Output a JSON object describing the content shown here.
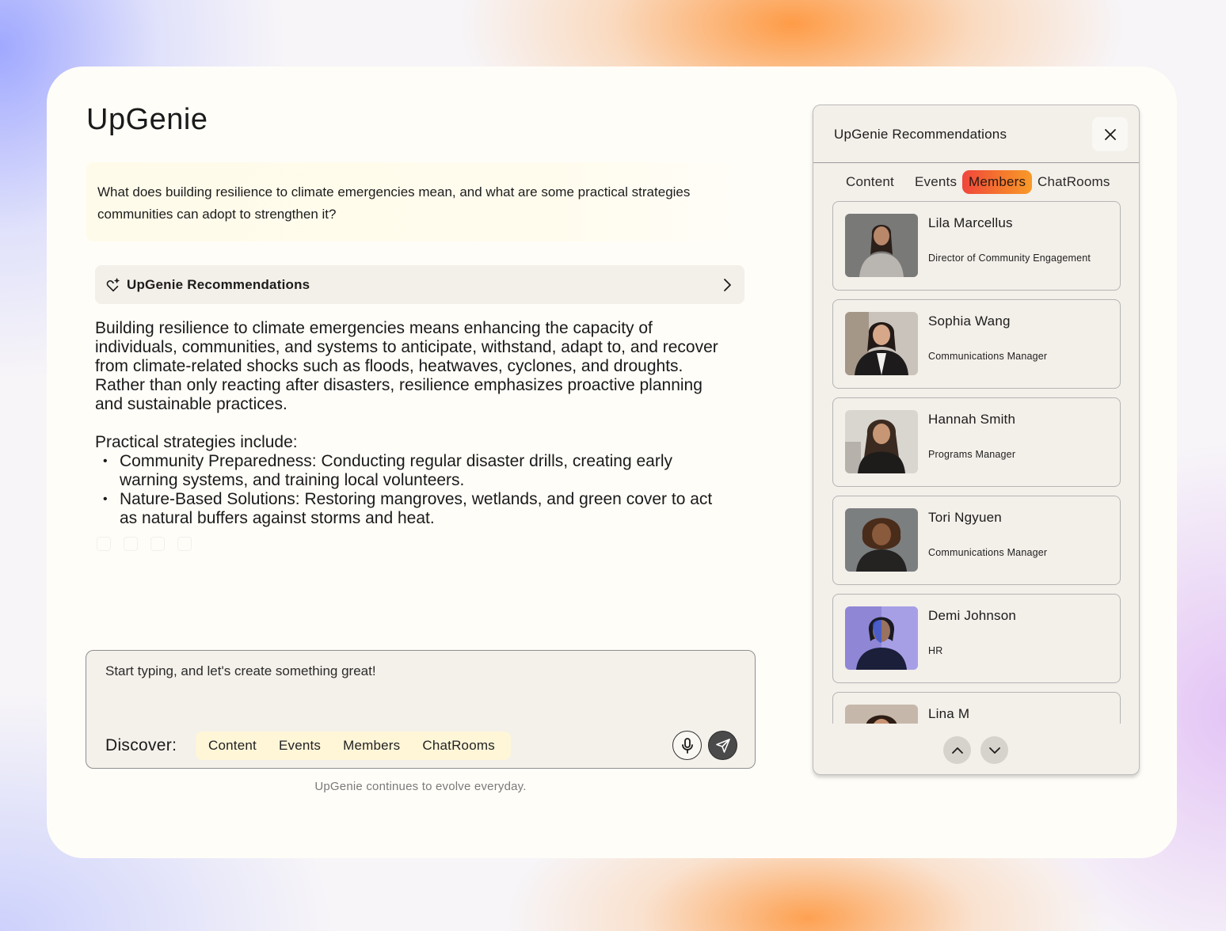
{
  "app": {
    "title": "UpGenie"
  },
  "question": "What does building resilience to climate emergencies mean, and what are some practical strategies communities can adopt to strengthen it?",
  "recommendations_bar": {
    "label": "UpGenie Recommendations",
    "icon": "sparkle-heart-icon"
  },
  "answer": {
    "paragraph": "Building resilience to climate emergencies means enhancing the capacity of individuals, communities, and systems to anticipate, withstand, adapt to, and recover from climate-related shocks such as floods, heatwaves, cyclones, and droughts. Rather than only reacting after disasters, resilience emphasizes proactive planning and sustainable practices.",
    "strategies_heading": "Practical strategies include:",
    "strategies": [
      "Community Preparedness: Conducting regular disaster drills, creating early warning systems, and training local volunteers.",
      "Nature-Based Solutions: Restoring mangroves, wetlands, and green cover to act as natural buffers against storms and heat."
    ]
  },
  "composer": {
    "placeholder": "Start typing, and let's create something great!",
    "discover_label": "Discover:",
    "chips": [
      "Content",
      "Events",
      "Members",
      "ChatRooms"
    ],
    "mic_icon": "microphone-icon",
    "send_icon": "send-icon"
  },
  "footnote": "UpGenie continues to evolve everyday.",
  "panel": {
    "title": "UpGenie Recommendations",
    "tabs": [
      "Content",
      "Events",
      "Members",
      "ChatRooms"
    ],
    "active_tab": "Members",
    "members": [
      {
        "name": "Lila Marcellus",
        "role": "Director of Community Engagement"
      },
      {
        "name": "Sophia Wang",
        "role": "Communications Manager"
      },
      {
        "name": "Hannah Smith",
        "role": "Programs Manager"
      },
      {
        "name": "Tori Ngyuen",
        "role": "Communications Manager"
      },
      {
        "name": "Demi Johnson",
        "role": "HR"
      },
      {
        "name": "Lina M",
        "role": ""
      }
    ]
  },
  "colors": {
    "active_tab_start": "#f0463c",
    "active_tab_end": "#f89a2a",
    "chip_bg": "#fff6d8",
    "card_bg": "#fffdf8"
  }
}
